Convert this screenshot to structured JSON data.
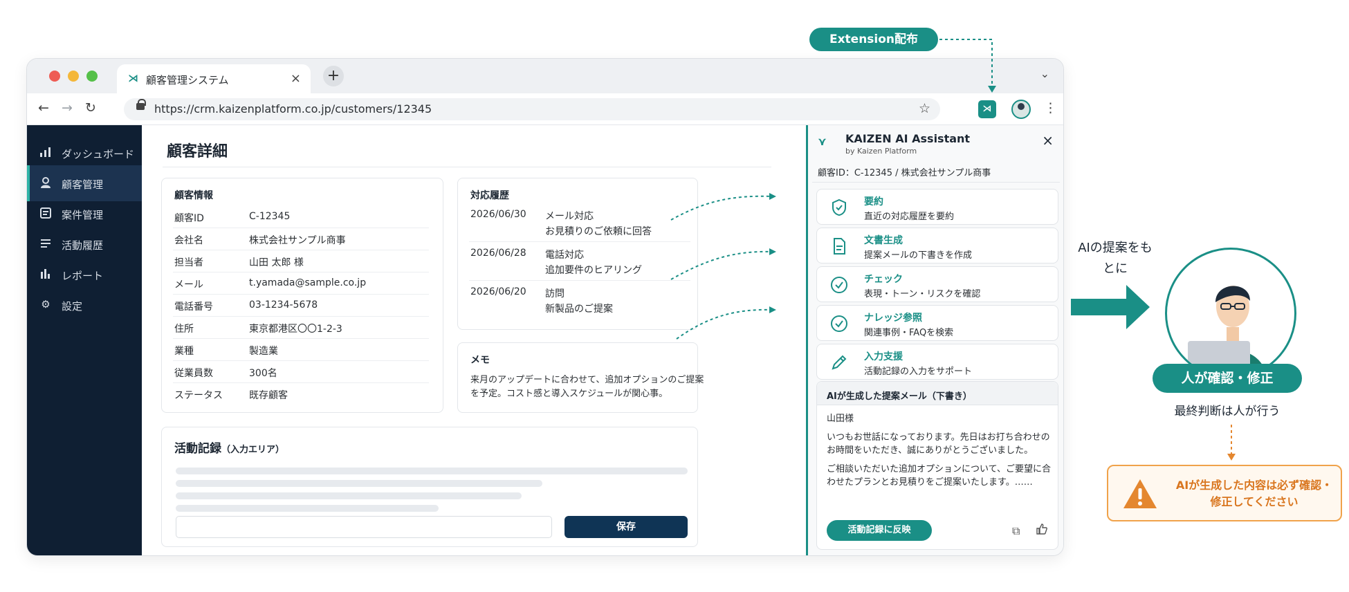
{
  "browser": {
    "tab_title": "顧客管理システム",
    "tab_close": "×",
    "new_tab": "+",
    "url": "https://crm.kaizenplatform.co.jp/customers/12345"
  },
  "sidebar": {
    "items": [
      {
        "label": "ダッシュボード",
        "icon": "bar-chart-icon"
      },
      {
        "label": "顧客管理",
        "icon": "user-icon",
        "active": true
      },
      {
        "label": "案件管理",
        "icon": "document-icon"
      },
      {
        "label": "活動履歴",
        "icon": "list-icon"
      },
      {
        "label": "レポート",
        "icon": "report-icon"
      },
      {
        "label": "設定",
        "icon": "gear-icon"
      }
    ]
  },
  "main": {
    "page_title": "顧客詳細",
    "customer_info": {
      "title": "顧客情報",
      "rows": [
        {
          "key": "顧客ID",
          "value": "C-12345"
        },
        {
          "key": "会社名",
          "value": "株式会社サンプル商事"
        },
        {
          "key": "担当者",
          "value": "山田 太郎 様"
        },
        {
          "key": "メール",
          "value": "t.yamada@sample.co.jp"
        },
        {
          "key": "電話番号",
          "value": "03-1234-5678"
        },
        {
          "key": "住所",
          "value": "東京都港区〇〇1-2-3"
        },
        {
          "key": "業種",
          "value": "製造業"
        },
        {
          "key": "従業員数",
          "value": "300名"
        },
        {
          "key": "ステータス",
          "value": "既存顧客"
        }
      ]
    },
    "history": {
      "title": "対応履歴",
      "rows": [
        {
          "date": "2026/06/30",
          "type": "メール対応",
          "detail": "お見積りのご依頼に回答"
        },
        {
          "date": "2026/06/28",
          "type": "電話対応",
          "detail": "追加要件のヒアリング"
        },
        {
          "date": "2026/06/20",
          "type": "訪問",
          "detail": "新製品のご提案"
        }
      ]
    },
    "memo": {
      "title": "メモ",
      "text": "来月のアップデートに合わせて、追加オプションのご提案を予定。コスト感と導入スケジュールが関心事。"
    },
    "activity": {
      "title": "活動記録",
      "title_suffix": "（入力エリア）",
      "save_label": "保存"
    }
  },
  "assistant": {
    "title": "KAIZEN AI Assistant",
    "subtitle": "by Kaizen Platform",
    "close": "×",
    "customer_line": "顧客ID：C-12345 / 株式会社サンプル商事",
    "features": [
      {
        "title": "要約",
        "desc": "直近の対応履歴を要約",
        "icon": "shield-check-icon"
      },
      {
        "title": "文書生成",
        "desc": "提案メールの下書きを作成",
        "icon": "document-icon"
      },
      {
        "title": "チェック",
        "desc": "表現・トーン・リスクを確認",
        "icon": "check-circle-icon"
      },
      {
        "title": "ナレッジ参照",
        "desc": "関連事例・FAQを検索",
        "icon": "check-circle-icon"
      },
      {
        "title": "入力支援",
        "desc": "活動記録の入力をサポート",
        "icon": "pencil-icon"
      }
    ],
    "draft": {
      "title": "AIが生成した提案メール（下書き）",
      "greeting": "山田様",
      "para1": "いつもお世話になっております。先日はお打ち合わせのお時間をいただき、誠にありがとうございました。",
      "para2": "ご相談いただいた追加オプションについて、ご要望に合わせたプランとお見積りをご提案いたします。……",
      "reflect_label": "活動記録に反映"
    }
  },
  "annotations": {
    "extension_label": "Extension配布",
    "ai_caption": "AIの提案をもとに",
    "role_label": "人が確認・修正",
    "final_judgment": "最終判断は人が行う",
    "warning": "AIが生成した内容は必ず確認・修正してください"
  },
  "colors": {
    "accent": "#1a8f86",
    "sidebar_bg": "#0f1f33",
    "save_button": "#0f3455",
    "warning": "#d9761f"
  }
}
